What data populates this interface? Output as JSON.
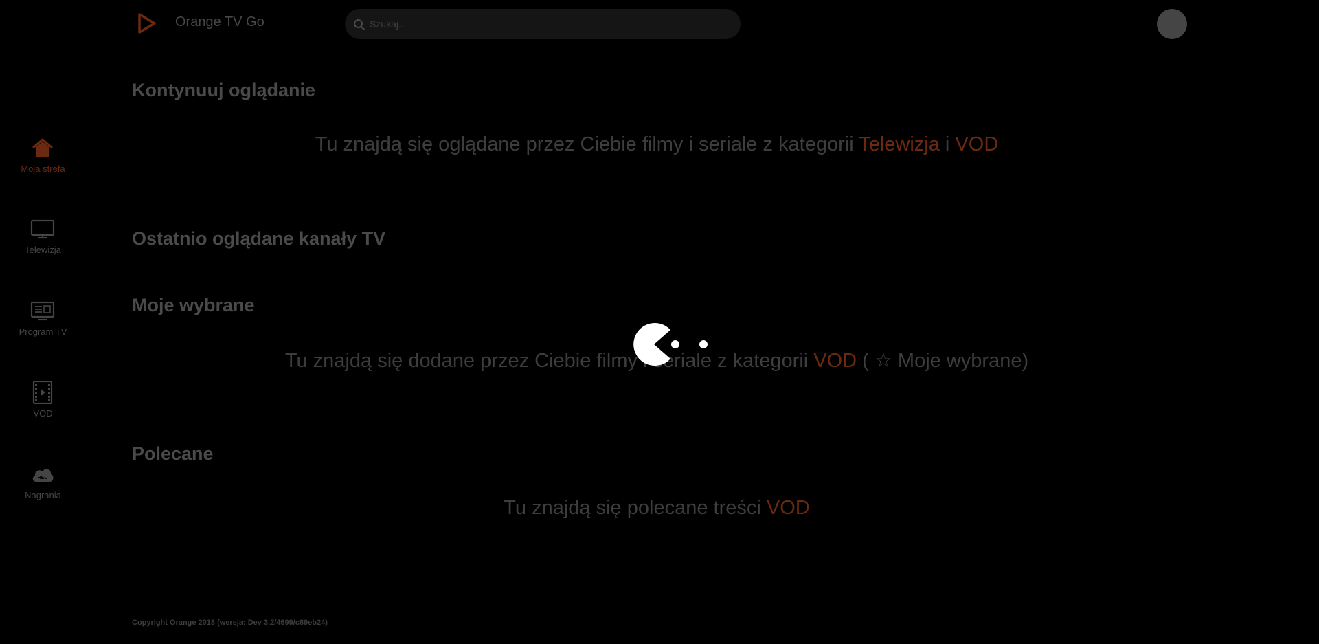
{
  "header": {
    "app_title": "Orange TV Go",
    "logo_icon": "play-triangle-icon",
    "search": {
      "placeholder": "Szukaj...",
      "value": "",
      "icon": "search-icon"
    },
    "avatar_icon": "avatar"
  },
  "sidebar": {
    "items": [
      {
        "label": "Moja strefa",
        "icon": "home-icon",
        "active": true
      },
      {
        "label": "Telewizja",
        "icon": "tv-icon",
        "active": false
      },
      {
        "label": "Program TV",
        "icon": "tv-guide-icon",
        "active": false
      },
      {
        "label": "VOD",
        "icon": "film-icon",
        "active": false
      },
      {
        "label": "Nagrania",
        "icon": "rec-cloud-icon",
        "active": false
      }
    ]
  },
  "sections": {
    "continue": {
      "title": "Kontynuuj oglądanie",
      "msg_prefix": "Tu znajdą się oglądane przez Ciebie filmy i seriale z kategorii ",
      "msg_link1": "Telewizja",
      "msg_mid": " i ",
      "msg_link2": "VOD"
    },
    "recent_channels": {
      "title": "Ostatnio oglądane kanały TV"
    },
    "favourites": {
      "title": "Moje wybrane",
      "msg_prefix": "Tu znajdą się dodane przez Ciebie filmy i seriale z kategorii ",
      "msg_link": "VOD",
      "msg_suffix": " ( ☆ Moje wybrane)"
    },
    "recommended": {
      "title": "Polecane",
      "msg_prefix": "Tu znajdą się polecane treści ",
      "msg_link": "VOD"
    }
  },
  "footer": {
    "copyright": "Copyright Orange 2018 (wersja: Dev 3.2/4699/c89eb24)"
  },
  "loader": {
    "icon": "pacman-loader-icon"
  },
  "colors": {
    "background": "#000000",
    "accent_dimmed": "#6b2a10",
    "text_dimmed": "#3d3d3d",
    "loader": "#ffffff"
  }
}
